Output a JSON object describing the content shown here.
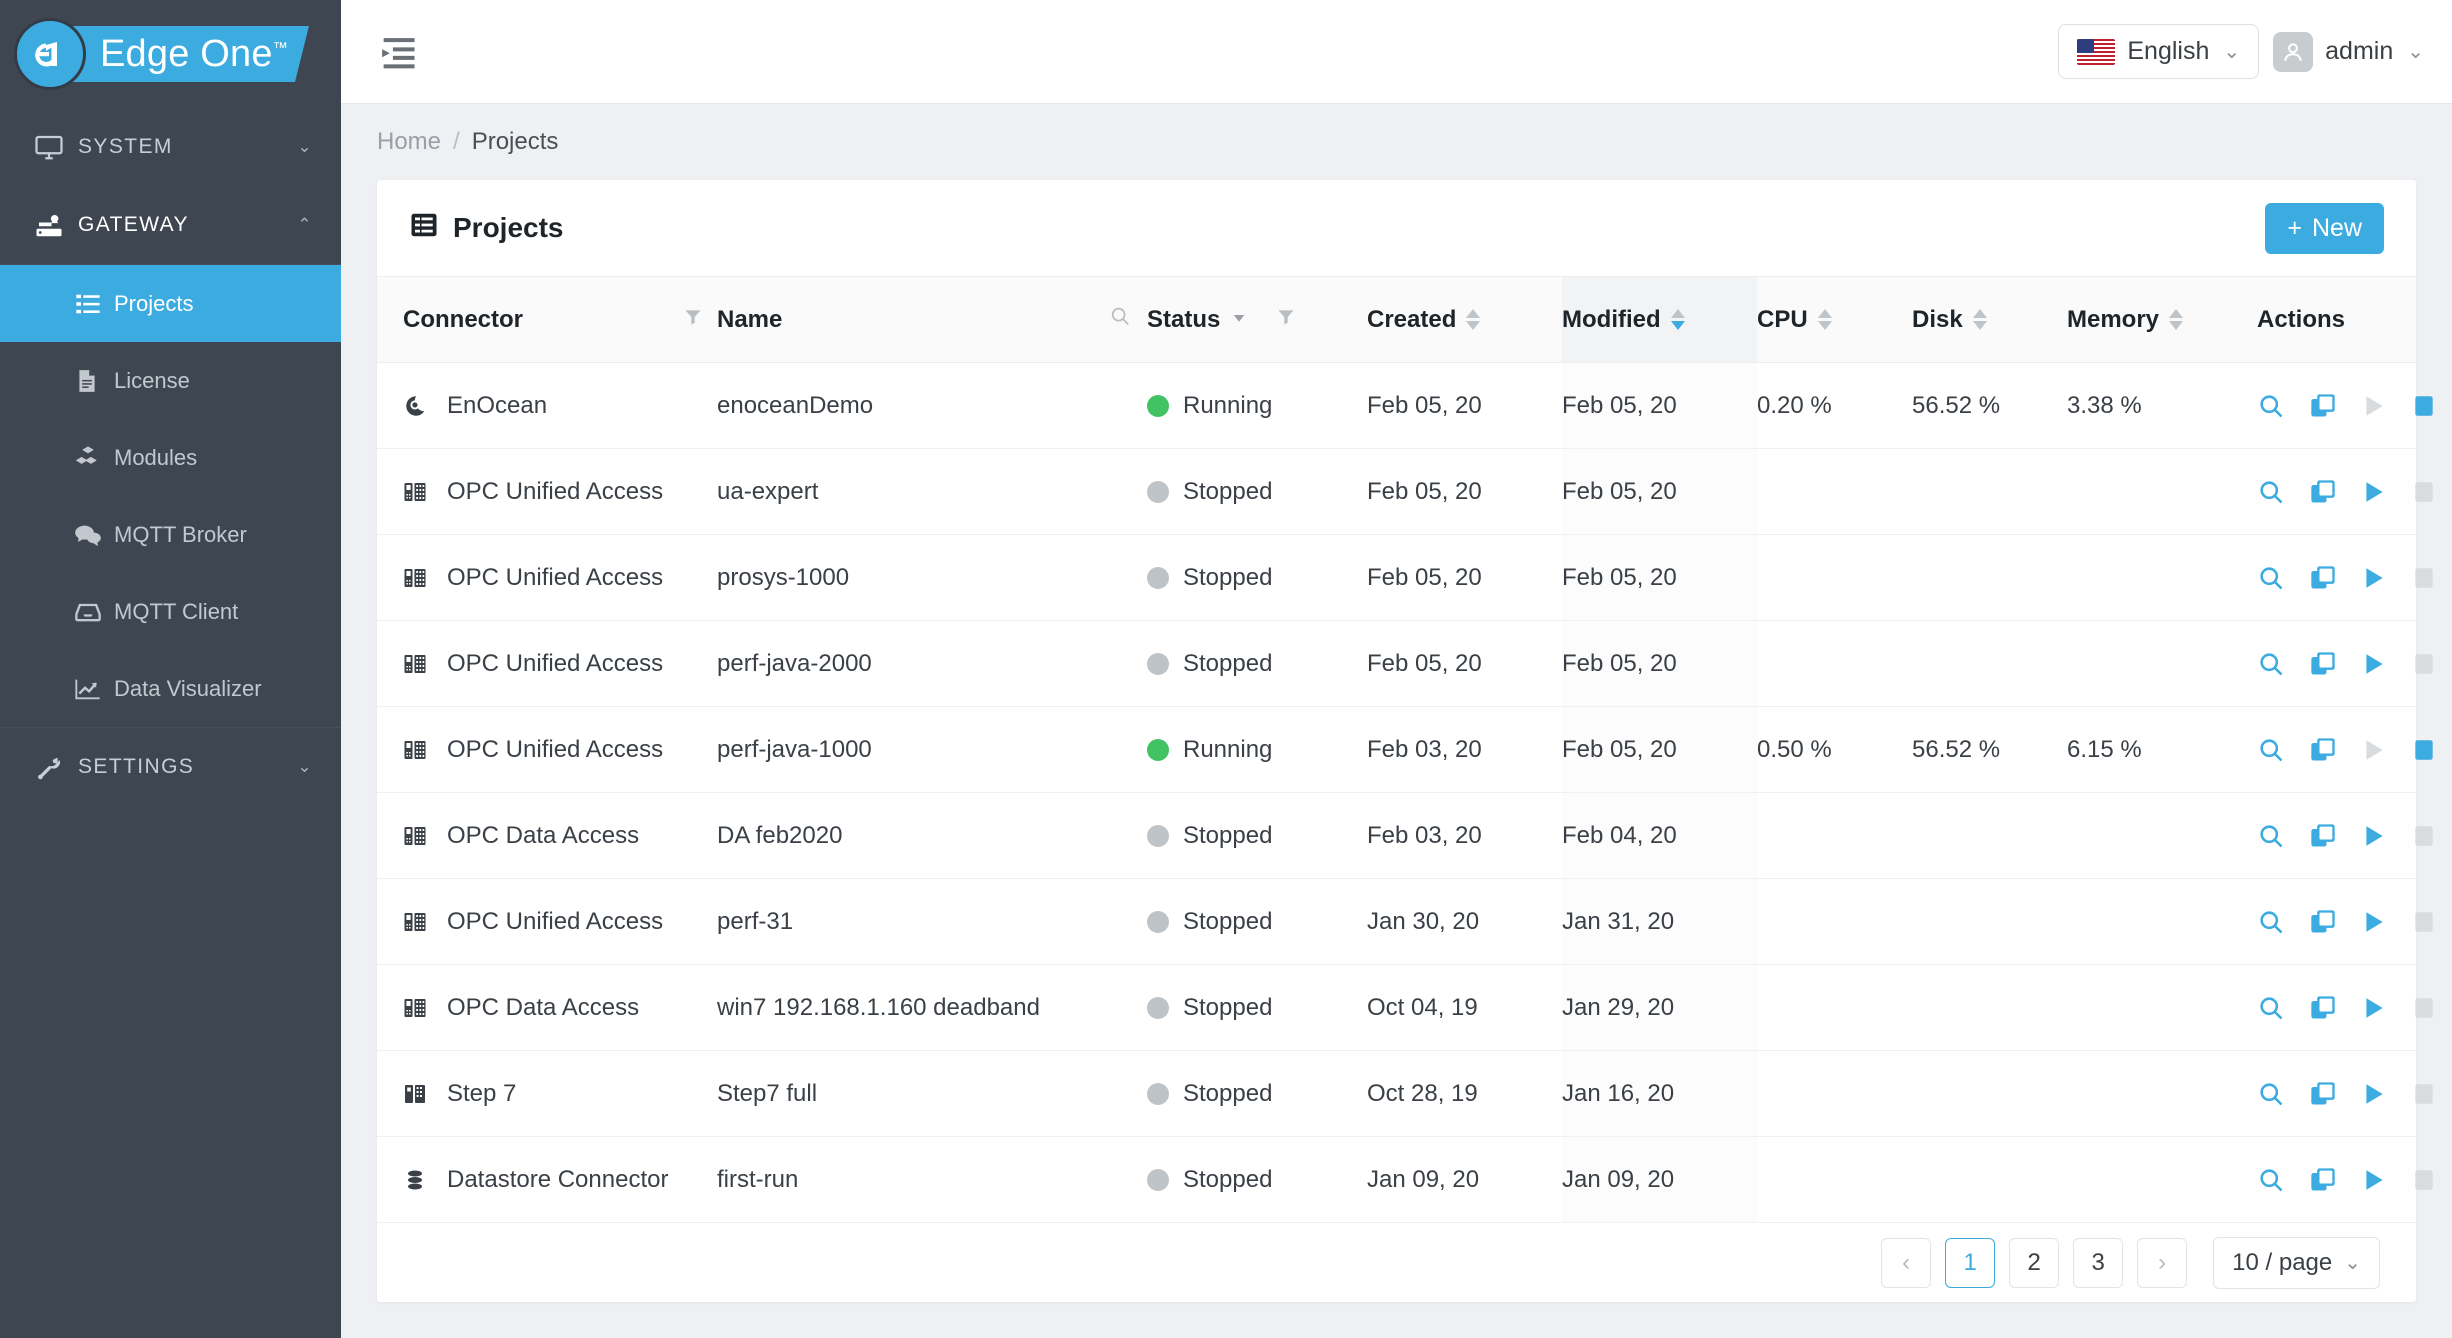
{
  "brand": {
    "name": "Edge One",
    "tm": "™"
  },
  "sidebar": {
    "groups": [
      {
        "label": "SYSTEM",
        "icon": "monitor-icon",
        "chevron": "⌄",
        "expanded": false
      },
      {
        "label": "GATEWAY",
        "icon": "gateway-icon",
        "chevron": "⌃",
        "expanded": true
      }
    ],
    "items": [
      {
        "label": "Projects",
        "icon": "list-icon",
        "selected": true
      },
      {
        "label": "License",
        "icon": "document-icon",
        "selected": false
      },
      {
        "label": "Modules",
        "icon": "boxes-icon",
        "selected": false
      },
      {
        "label": "MQTT Broker",
        "icon": "chat-bubbles-icon",
        "selected": false
      },
      {
        "label": "MQTT Client",
        "icon": "inbox-icon",
        "selected": false
      },
      {
        "label": "Data Visualizer",
        "icon": "chart-line-icon",
        "selected": false
      }
    ],
    "settings": {
      "label": "SETTINGS",
      "icon": "wrench-icon",
      "chevron": "⌄"
    }
  },
  "topbar": {
    "collapse_icon": "menu-indent-icon",
    "language": {
      "label": "English",
      "caret": "⌄",
      "flag": "us-flag-icon"
    },
    "user": {
      "name": "admin",
      "caret": "⌄",
      "avatar_icon": "user-icon"
    }
  },
  "breadcrumb": {
    "home": "Home",
    "sep": "/",
    "current": "Projects"
  },
  "card": {
    "title": "Projects",
    "title_icon": "table-icon",
    "new_button": {
      "label": "New",
      "plus": "+"
    }
  },
  "table": {
    "columns": [
      {
        "key": "connector",
        "label": "Connector",
        "filter": true,
        "sortable": false,
        "search": false
      },
      {
        "key": "name",
        "label": "Name",
        "filter": false,
        "sortable": false,
        "search": true
      },
      {
        "key": "status",
        "label": "Status",
        "filter": true,
        "sortable": false,
        "search": false,
        "dropdown": true
      },
      {
        "key": "created",
        "label": "Created",
        "filter": false,
        "sortable": true,
        "sort": "none"
      },
      {
        "key": "modified",
        "label": "Modified",
        "filter": false,
        "sortable": true,
        "sort": "desc"
      },
      {
        "key": "cpu",
        "label": "CPU",
        "filter": false,
        "sortable": true,
        "sort": "none"
      },
      {
        "key": "disk",
        "label": "Disk",
        "filter": false,
        "sortable": true,
        "sort": "none"
      },
      {
        "key": "memory",
        "label": "Memory",
        "filter": false,
        "sortable": true,
        "sort": "none"
      },
      {
        "key": "actions",
        "label": "Actions",
        "filter": false,
        "sortable": false
      }
    ],
    "rows": [
      {
        "connector": "EnOcean",
        "connector_icon": "enocean-icon",
        "name": "enoceanDemo",
        "status": "Running",
        "created": "Feb 05, 20",
        "modified": "Feb 05, 20",
        "cpu": "0.20 %",
        "disk": "56.52 %",
        "memory": "3.38 %"
      },
      {
        "connector": "OPC Unified Access",
        "connector_icon": "opc-icon",
        "name": "ua-expert",
        "status": "Stopped",
        "created": "Feb 05, 20",
        "modified": "Feb 05, 20",
        "cpu": "",
        "disk": "",
        "memory": ""
      },
      {
        "connector": "OPC Unified Access",
        "connector_icon": "opc-icon",
        "name": "prosys-1000",
        "status": "Stopped",
        "created": "Feb 05, 20",
        "modified": "Feb 05, 20",
        "cpu": "",
        "disk": "",
        "memory": ""
      },
      {
        "connector": "OPC Unified Access",
        "connector_icon": "opc-icon",
        "name": "perf-java-2000",
        "status": "Stopped",
        "created": "Feb 05, 20",
        "modified": "Feb 05, 20",
        "cpu": "",
        "disk": "",
        "memory": ""
      },
      {
        "connector": "OPC Unified Access",
        "connector_icon": "opc-icon",
        "name": "perf-java-1000",
        "status": "Running",
        "created": "Feb 03, 20",
        "modified": "Feb 05, 20",
        "cpu": "0.50 %",
        "disk": "56.52 %",
        "memory": "6.15 %"
      },
      {
        "connector": "OPC Data Access",
        "connector_icon": "opc-icon",
        "name": "DA feb2020",
        "status": "Stopped",
        "created": "Feb 03, 20",
        "modified": "Feb 04, 20",
        "cpu": "",
        "disk": "",
        "memory": ""
      },
      {
        "connector": "OPC Unified Access",
        "connector_icon": "opc-icon",
        "name": "perf-31",
        "status": "Stopped",
        "created": "Jan 30, 20",
        "modified": "Jan 31, 20",
        "cpu": "",
        "disk": "",
        "memory": ""
      },
      {
        "connector": "OPC Data Access",
        "connector_icon": "opc-icon",
        "name": "win7 192.168.1.160 deadband",
        "status": "Stopped",
        "created": "Oct 04, 19",
        "modified": "Jan 29, 20",
        "cpu": "",
        "disk": "",
        "memory": ""
      },
      {
        "connector": "Step 7",
        "connector_icon": "step7-icon",
        "name": "Step7 full",
        "status": "Stopped",
        "created": "Oct 28, 19",
        "modified": "Jan 16, 20",
        "cpu": "",
        "disk": "",
        "memory": ""
      },
      {
        "connector": "Datastore Connector",
        "connector_icon": "datastore-icon",
        "name": "first-run",
        "status": "Stopped",
        "created": "Jan 09, 20",
        "modified": "Jan 09, 20",
        "cpu": "",
        "disk": "",
        "memory": ""
      }
    ],
    "row_actions": [
      {
        "name": "view-action",
        "icon": "magnifier-icon"
      },
      {
        "name": "copy-action",
        "icon": "copy-icon"
      },
      {
        "name": "start-action",
        "icon": "play-icon"
      },
      {
        "name": "stop-action",
        "icon": "stop-icon"
      }
    ]
  },
  "pagination": {
    "prev": "‹",
    "next": "›",
    "pages": [
      "1",
      "2",
      "3"
    ],
    "current": "1",
    "page_size": "10 / page",
    "page_size_caret": "⌄"
  },
  "colors": {
    "accent": "#3cabe0",
    "sidebar": "#3e4651",
    "running": "#41c263",
    "stopped": "#bdc3c7",
    "disabled": "#d8dcdf"
  }
}
